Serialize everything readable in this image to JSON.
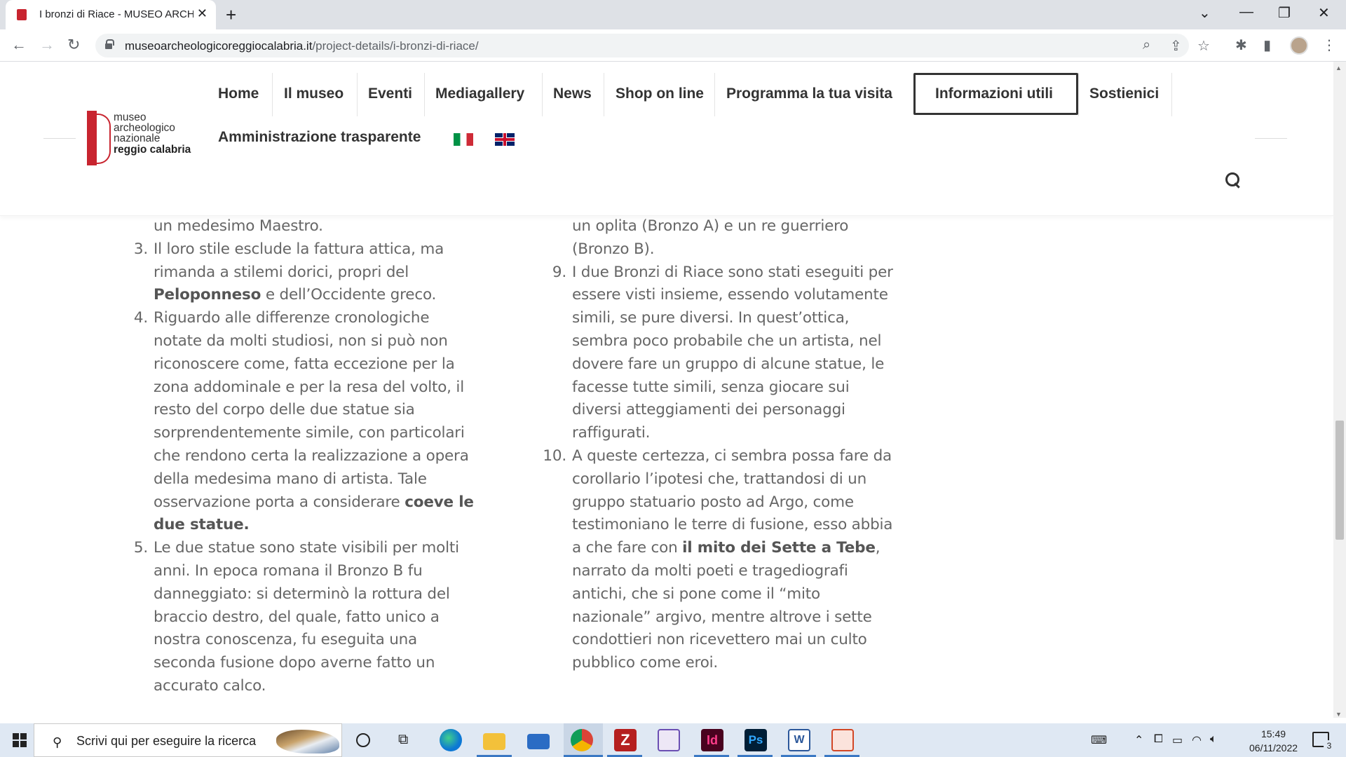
{
  "browser": {
    "tab_title": "I bronzi di Riace - MUSEO ARCHE",
    "tab_close": "✕",
    "new_tab": "+",
    "url_domain": "museoarcheologicoreggiocalabria.it",
    "url_path": "/project-details/i-bronzi-di-riace/",
    "back": "←",
    "forward": "→",
    "reload": "↻",
    "window_dropdown": "⌄",
    "minimize": "—",
    "maximize": "❐",
    "close": "✕",
    "zoom_icon": "⌕",
    "share_icon": "⇪",
    "bookmark_icon": "☆",
    "extensions_icon": "✱",
    "sidepanel_icon": "▮",
    "menu_icon": "⋮"
  },
  "site": {
    "logo_lines": [
      "museo",
      "archeologico",
      "nazionale",
      "reggio calabria"
    ],
    "menu": [
      "Home",
      "Il museo",
      "Eventi",
      "Mediagallery",
      "News",
      "Shop on line",
      "Programma la tua visita",
      "Informazioni utili",
      "Sostienici"
    ],
    "menu_row2": "Amministrazione trasparente"
  },
  "content": {
    "left": [
      {
        "num": "",
        "lines": [
          "un medesimo Maestro."
        ]
      },
      {
        "num": "3.",
        "lines": [
          "Il loro stile esclude la fattura attica, ma",
          "rimanda a stilemi dorici, propri del"
        ],
        "bold_line": {
          "bold": "Peloponneso",
          "rest": " e dell’Occidente greco."
        }
      },
      {
        "num": "4.",
        "lines": [
          "Riguardo alle differenze cronologiche",
          "notate da molti studiosi, non si può non",
          "riconoscere come, fatta eccezione per la",
          "zona addominale e per la resa del volto, il",
          "resto del corpo delle due statue sia",
          "sorprendentemente simile, con particolari",
          "che rendono certa la realizzazione a opera",
          "della medesima mano di artista. Tale"
        ],
        "mixed_line": {
          "pre": "osservazione porta a considerare ",
          "bold": "coeve le"
        },
        "bold_end": "due statue."
      },
      {
        "num": "5.",
        "lines": [
          "Le due statue sono state visibili per molti",
          "anni. In epoca romana il Bronzo B fu",
          "danneggiato: si determinò la rottura del",
          "braccio destro, del quale, fatto unico a",
          "nostra conoscenza, fu eseguita una",
          "seconda fusione dopo averne fatto un",
          "accurato calco."
        ]
      }
    ],
    "right": [
      {
        "num": "",
        "lines": [
          "un oplita (Bronzo A) e un re guerriero",
          "(Bronzo B)."
        ]
      },
      {
        "num": "9.",
        "lines": [
          "I due Bronzi di Riace sono stati eseguiti per",
          "essere visti insieme, essendo volutamente",
          "simili, se pure diversi. In quest’ottica,",
          "sembra poco probabile che un artista, nel",
          "dovere fare un gruppo di alcune statue, le",
          "facesse tutte simili, senza giocare sui",
          "diversi atteggiamenti dei personaggi",
          "raffigurati."
        ]
      },
      {
        "num": "10.",
        "lines": [
          "A queste certezza, ci sembra possa fare da",
          "corollario l’ipotesi che, trattandosi di un",
          "gruppo statuario posto ad Argo, come",
          "testimoniano le terre di fusione, esso abbia"
        ],
        "mixed_line": {
          "pre": "a che fare con ",
          "bold": "il mito dei Sette a Tebe",
          "post": ","
        },
        "lines_after": [
          "narrato da molti poeti e tragediografi",
          "antichi, che si pone come il “mito",
          "nazionale” argivo, mentre altrove i sette",
          "condottieri non ricevettero mai un culto",
          "pubblico come eroi."
        ]
      }
    ]
  },
  "taskbar": {
    "search_placeholder": "Scrivi qui per eseguire la ricerca",
    "time": "15:49",
    "date": "06/11/2022",
    "notifications": "3"
  },
  "colors": {
    "brand_red": "#c8242f",
    "text_gray": "#666666"
  }
}
